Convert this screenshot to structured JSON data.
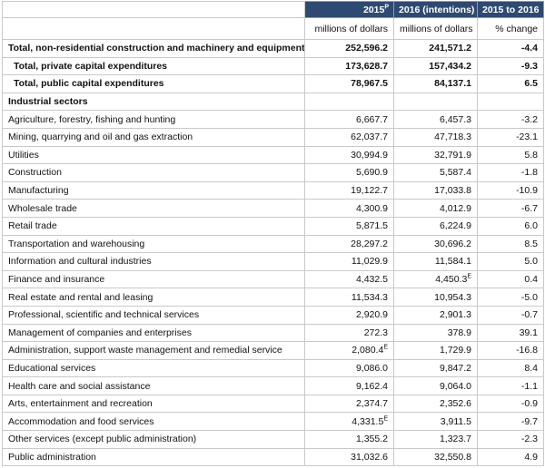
{
  "header": {
    "col1": "2015",
    "col1_sup": "P",
    "col2": "2016 (intentions)",
    "col3": "2015 to 2016"
  },
  "units": {
    "col1": "millions of dollars",
    "col2": "millions of dollars",
    "col3": "% change"
  },
  "rows": [
    {
      "label": "Total, non-residential construction and machinery and equipment",
      "v2015": "252,596.2",
      "f2015": "",
      "v2016": "241,571.2",
      "f2016": "",
      "pct": "-4.4"
    },
    {
      "label": "Total, private capital expenditures",
      "v2015": "173,628.7",
      "f2015": "",
      "v2016": "157,434.2",
      "f2016": "",
      "pct": "-9.3"
    },
    {
      "label": "Total, public capital expenditures",
      "v2015": "78,967.5",
      "f2015": "",
      "v2016": "84,137.1",
      "f2016": "",
      "pct": "6.5"
    },
    {
      "label": "Industrial sectors",
      "v2015": "",
      "f2015": "",
      "v2016": "",
      "f2016": "",
      "pct": ""
    },
    {
      "label": "Agriculture, forestry, fishing and hunting",
      "v2015": "6,667.7",
      "f2015": "",
      "v2016": "6,457.3",
      "f2016": "",
      "pct": "-3.2"
    },
    {
      "label": "Mining, quarrying and oil and gas extraction",
      "v2015": "62,037.7",
      "f2015": "",
      "v2016": "47,718.3",
      "f2016": "",
      "pct": "-23.1"
    },
    {
      "label": "Utilities",
      "v2015": "30,994.9",
      "f2015": "",
      "v2016": "32,791.9",
      "f2016": "",
      "pct": "5.8"
    },
    {
      "label": "Construction",
      "v2015": "5,690.9",
      "f2015": "",
      "v2016": "5,587.4",
      "f2016": "",
      "pct": "-1.8"
    },
    {
      "label": "Manufacturing",
      "v2015": "19,122.7",
      "f2015": "",
      "v2016": "17,033.8",
      "f2016": "",
      "pct": "-10.9"
    },
    {
      "label": "Wholesale trade",
      "v2015": "4,300.9",
      "f2015": "",
      "v2016": "4,012.9",
      "f2016": "",
      "pct": "-6.7"
    },
    {
      "label": "Retail trade",
      "v2015": "5,871.5",
      "f2015": "",
      "v2016": "6,224.9",
      "f2016": "",
      "pct": "6.0"
    },
    {
      "label": "Transportation and warehousing",
      "v2015": "28,297.2",
      "f2015": "",
      "v2016": "30,696.2",
      "f2016": "",
      "pct": "8.5"
    },
    {
      "label": "Information and cultural industries",
      "v2015": "11,029.9",
      "f2015": "",
      "v2016": "11,584.1",
      "f2016": "",
      "pct": "5.0"
    },
    {
      "label": "Finance and insurance",
      "v2015": "4,432.5",
      "f2015": "",
      "v2016": "4,450.3",
      "f2016": "E",
      "pct": "0.4"
    },
    {
      "label": "Real estate and rental and leasing",
      "v2015": "11,534.3",
      "f2015": "",
      "v2016": "10,954.3",
      "f2016": "",
      "pct": "-5.0"
    },
    {
      "label": "Professional, scientific and technical services",
      "v2015": "2,920.9",
      "f2015": "",
      "v2016": "2,901.3",
      "f2016": "",
      "pct": "-0.7"
    },
    {
      "label": "Management of companies and enterprises",
      "v2015": "272.3",
      "f2015": "",
      "v2016": "378.9",
      "f2016": "",
      "pct": "39.1"
    },
    {
      "label": "Administration, support waste management and remedial service",
      "v2015": "2,080.4",
      "f2015": "E",
      "v2016": "1,729.9",
      "f2016": "",
      "pct": "-16.8"
    },
    {
      "label": "Educational services",
      "v2015": "9,086.0",
      "f2015": "",
      "v2016": "9,847.2",
      "f2016": "",
      "pct": "8.4"
    },
    {
      "label": "Health care and social assistance",
      "v2015": "9,162.4",
      "f2015": "",
      "v2016": "9,064.0",
      "f2016": "",
      "pct": "-1.1"
    },
    {
      "label": "Arts, entertainment and recreation",
      "v2015": "2,374.7",
      "f2015": "",
      "v2016": "2,352.6",
      "f2016": "",
      "pct": "-0.9"
    },
    {
      "label": "Accommodation and food services",
      "v2015": "4,331.5",
      "f2015": "E",
      "v2016": "3,911.5",
      "f2016": "",
      "pct": "-9.7"
    },
    {
      "label": "Other services (except public administration)",
      "v2015": "1,355.2",
      "f2015": "",
      "v2016": "1,323.7",
      "f2016": "",
      "pct": "-2.3"
    },
    {
      "label": "Public administration",
      "v2015": "31,032.6",
      "f2015": "",
      "v2016": "32,550.8",
      "f2016": "",
      "pct": "4.9"
    }
  ]
}
